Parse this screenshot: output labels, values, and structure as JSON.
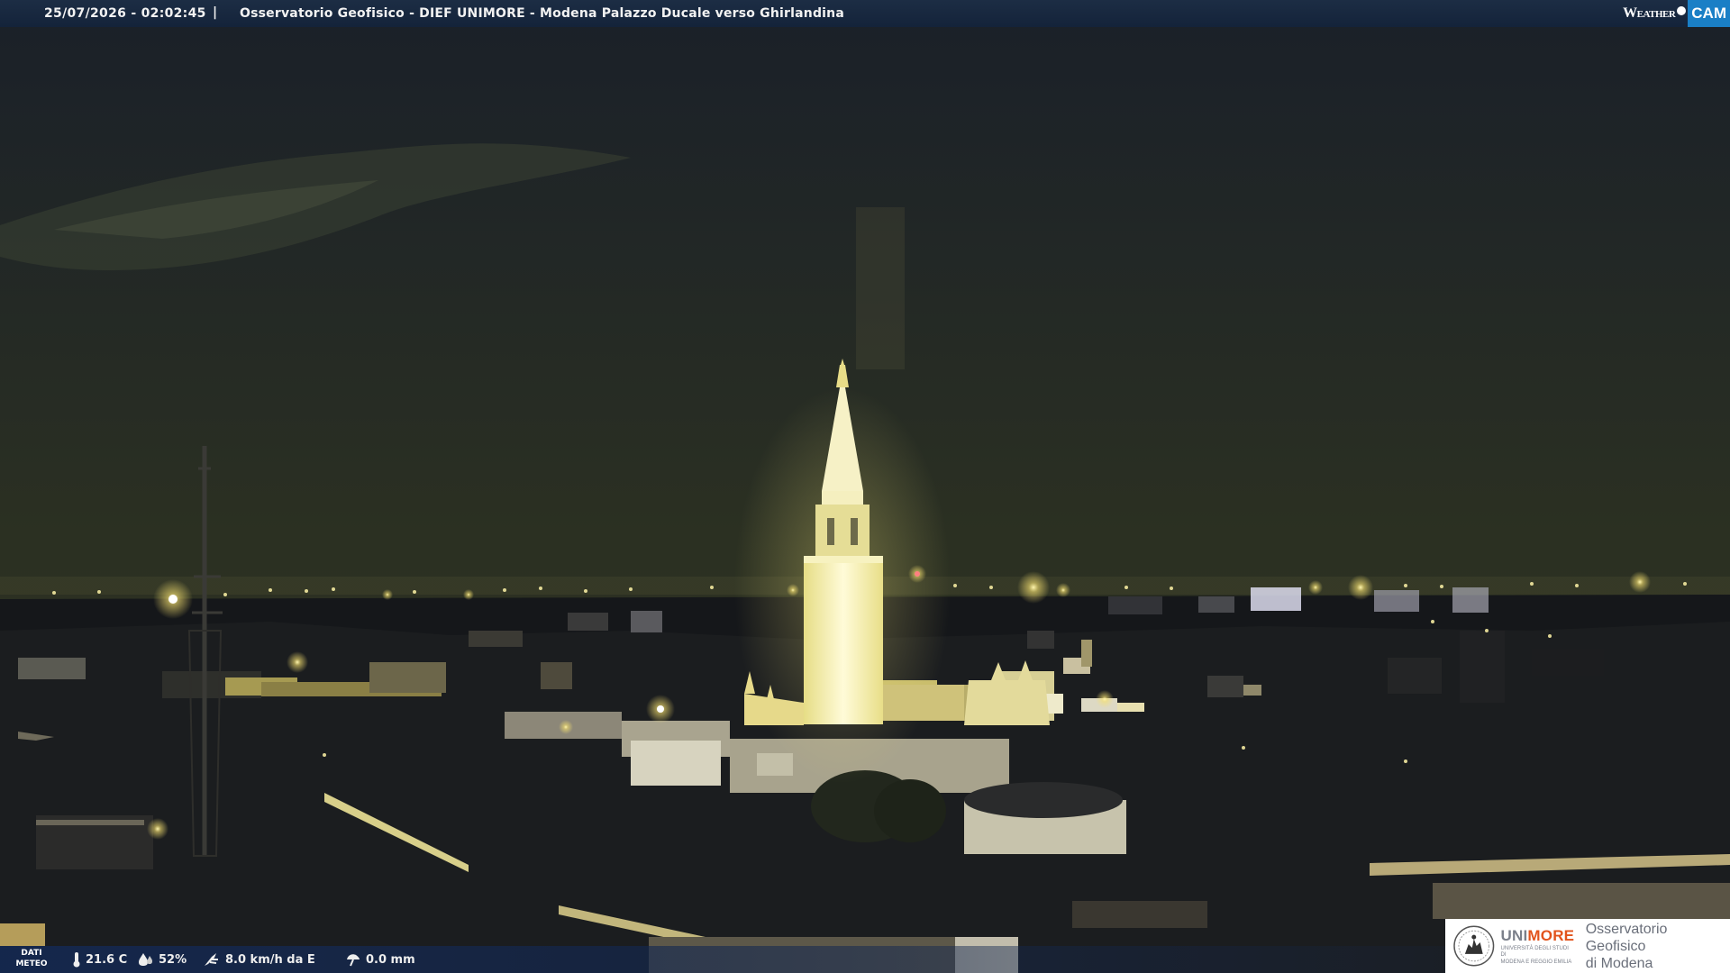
{
  "header": {
    "datetime": "25/07/2026 - 02:02:45",
    "separator": "|",
    "title": "Osservatorio Geofisico - DIEF UNIMORE - Modena Palazzo Ducale verso Ghirlandina"
  },
  "brand": {
    "weather": "Weather",
    "cam": "CAM",
    "accent_color": "#1a7fc6"
  },
  "weather_bar": {
    "label_line1": "DATI",
    "label_line2": "METEO",
    "temperature": "21.6 C",
    "humidity": "52%",
    "wind": "8.0 km/h da E",
    "rain": "0.0 mm",
    "icons": [
      "thermometer-icon",
      "humidity-drop-icon",
      "wind-icon",
      "rain-umbrella-icon"
    ]
  },
  "logo": {
    "uni_part1": "UNI",
    "uni_part2": "MORE",
    "uni_subtitle_line1": "UNIVERSITÀ DEGLI STUDI DI",
    "uni_subtitle_line2": "MODENA E REGGIO EMILIA",
    "observatory_line1": "Osservatorio Geofisico",
    "observatory_line2": "di Modena"
  }
}
